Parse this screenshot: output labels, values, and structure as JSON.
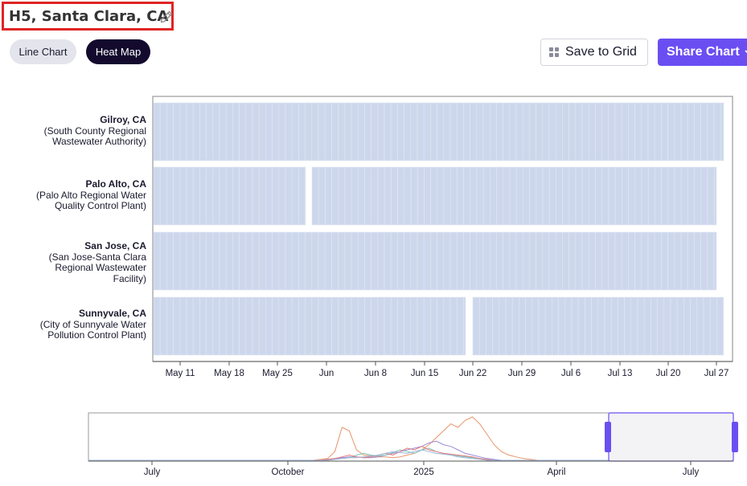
{
  "header": {
    "title": "H5, Santa Clara, CA",
    "edit_icon": "pencil-icon"
  },
  "view_toggle": {
    "line_chart_label": "Line Chart",
    "heat_map_label": "Heat Map",
    "active": "Heat Map"
  },
  "actions": {
    "save_label": "Save to Grid",
    "share_label": "Share Chart",
    "save_icon": "grid-icon",
    "share_icon": "chevron-down-icon"
  },
  "colors": {
    "accent": "#6b4ef2",
    "heat_cell": "#cdd7ec",
    "active_toggle": "#130a2e"
  },
  "chart_data": [
    {
      "type": "heatmap",
      "x_ticks": [
        "May 11",
        "May 18",
        "May 25",
        "Jun",
        "Jun 8",
        "Jun 15",
        "Jun 22",
        "Jun 29",
        "Jul 6",
        "Jul 13",
        "Jul 20",
        "Jul 27"
      ],
      "rows": [
        {
          "name": "Gilroy, CA",
          "facility": "(South County Regional",
          "facility2": "Wastewater Authority)",
          "facility3": "",
          "gaps": []
        },
        {
          "name": "Palo Alto, CA",
          "facility": "(Palo Alto Regional Water",
          "facility2": "Quality Control Plant)",
          "facility3": "",
          "gaps": [
            "May 29"
          ]
        },
        {
          "name": "San Jose, CA",
          "facility": "(San Jose-Santa Clara",
          "facility2": "Regional Wastewater",
          "facility3": "Facility)",
          "gaps": []
        },
        {
          "name": "Sunnyvale, CA",
          "facility": "(City of Sunnyvale Water",
          "facility2": "Pollution Control Plant)",
          "facility3": "",
          "gaps": [
            "Jun 21"
          ]
        }
      ]
    },
    {
      "type": "line",
      "role": "time-range-navigator",
      "x_ticks": [
        "July",
        "October",
        "2025",
        "April",
        "July"
      ],
      "series": [
        {
          "color": "#e8956a",
          "values": [
            0,
            0,
            0,
            0,
            0,
            0,
            0,
            0,
            0,
            0,
            0,
            0,
            0,
            0,
            0,
            0,
            0,
            0,
            0,
            0,
            0,
            0,
            0,
            0,
            0,
            0,
            0,
            0,
            0,
            0,
            0,
            0,
            1,
            2,
            10,
            38,
            34,
            12,
            6,
            5,
            4,
            4,
            3,
            4,
            6,
            8,
            12,
            18,
            26,
            34,
            42,
            38,
            46,
            50,
            42,
            30,
            18,
            10,
            6,
            4,
            2,
            1,
            0,
            0,
            0,
            0,
            0,
            0,
            0,
            0,
            0,
            0,
            0,
            0,
            0,
            0,
            0,
            0,
            0,
            0,
            0,
            0,
            0,
            0,
            0,
            0,
            0,
            0,
            0,
            0
          ]
        },
        {
          "color": "#9b8ad8",
          "values": [
            0,
            0,
            0,
            0,
            0,
            0,
            0,
            0,
            0,
            0,
            0,
            0,
            0,
            0,
            0,
            0,
            0,
            0,
            0,
            0,
            0,
            0,
            0,
            0,
            0,
            0,
            0,
            0,
            0,
            0,
            0,
            0,
            0,
            1,
            2,
            3,
            4,
            4,
            3,
            3,
            4,
            6,
            8,
            10,
            12,
            14,
            16,
            20,
            22,
            18,
            16,
            12,
            8,
            6,
            4,
            2,
            1,
            0,
            0,
            0,
            0,
            0,
            0,
            0,
            0,
            0,
            0,
            0,
            0,
            0,
            0,
            0,
            0,
            0,
            0,
            0,
            0,
            0,
            0,
            0,
            0,
            0,
            0,
            0,
            0,
            0,
            0,
            0,
            0,
            0
          ]
        },
        {
          "color": "#7fc4b8",
          "values": [
            0,
            0,
            0,
            0,
            0,
            0,
            0,
            0,
            0,
            0,
            0,
            0,
            0,
            0,
            0,
            0,
            0,
            0,
            0,
            0,
            0,
            0,
            0,
            0,
            0,
            0,
            0,
            0,
            0,
            0,
            0,
            0,
            0,
            0,
            1,
            2,
            3,
            6,
            8,
            6,
            5,
            6,
            9,
            12,
            10,
            8,
            12,
            14,
            10,
            8,
            6,
            5,
            4,
            3,
            2,
            1,
            0,
            0,
            0,
            0,
            0,
            0,
            0,
            0,
            0,
            0,
            0,
            0,
            0,
            0,
            0,
            0,
            0,
            0,
            0,
            0,
            0,
            0,
            0,
            0,
            0,
            0,
            0,
            0,
            0,
            0,
            0,
            0,
            0,
            0
          ]
        },
        {
          "color": "#e07a7a",
          "values": [
            0,
            0,
            0,
            0,
            0,
            0,
            0,
            0,
            0,
            0,
            0,
            0,
            0,
            0,
            0,
            0,
            0,
            0,
            0,
            0,
            0,
            0,
            0,
            0,
            0,
            0,
            0,
            0,
            0,
            0,
            0,
            0,
            0,
            1,
            2,
            4,
            6,
            4,
            3,
            4,
            6,
            8,
            6,
            10,
            14,
            12,
            16,
            12,
            10,
            8,
            7,
            6,
            5,
            4,
            2,
            1,
            0,
            0,
            0,
            0,
            0,
            0,
            0,
            0,
            0,
            0,
            0,
            0,
            0,
            0,
            0,
            0,
            0,
            0,
            0,
            0,
            0,
            0,
            0,
            0,
            0,
            0,
            0,
            0,
            0,
            0,
            0,
            0,
            0,
            0
          ]
        },
        {
          "color": "#a0b4d8",
          "values": [
            0,
            0,
            0,
            0,
            0,
            0,
            0,
            0,
            0,
            0,
            0,
            0,
            0,
            0,
            0,
            0,
            0,
            0,
            0,
            0,
            0,
            0,
            0,
            0,
            0,
            0,
            0,
            0,
            0,
            0,
            0,
            0,
            0,
            0,
            1,
            2,
            3,
            3,
            4,
            5,
            6,
            8,
            10,
            9,
            8,
            10,
            12,
            10,
            8,
            7,
            6,
            4,
            3,
            2,
            1,
            0,
            0,
            0,
            0,
            0,
            0,
            0,
            0,
            0,
            0,
            0,
            0,
            0,
            0,
            0,
            0,
            0,
            0,
            0,
            0,
            0,
            0,
            0,
            0,
            0,
            0,
            0,
            0,
            0,
            0,
            0,
            0,
            0,
            0,
            0
          ]
        }
      ],
      "selected_range": [
        "May",
        "July"
      ]
    }
  ]
}
